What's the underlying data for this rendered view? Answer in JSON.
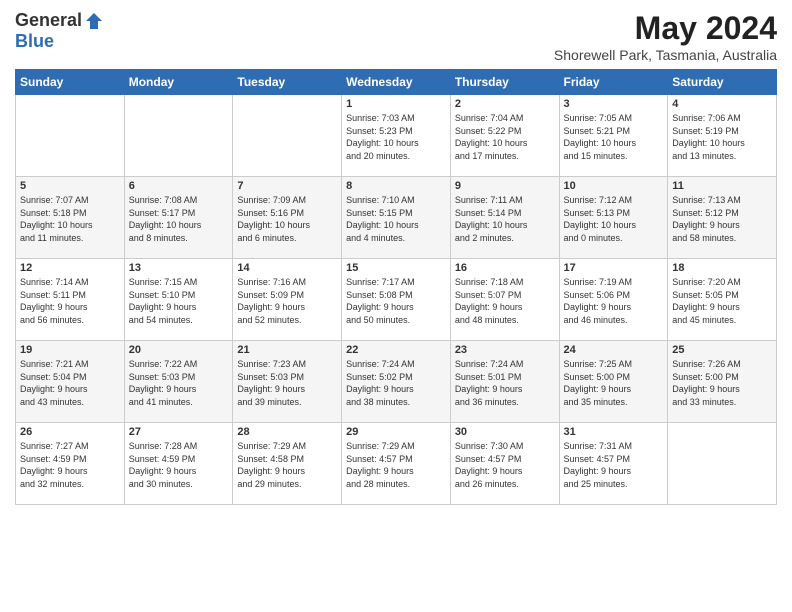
{
  "logo": {
    "general": "General",
    "blue": "Blue"
  },
  "title": "May 2024",
  "subtitle": "Shorewell Park, Tasmania, Australia",
  "days_of_week": [
    "Sunday",
    "Monday",
    "Tuesday",
    "Wednesday",
    "Thursday",
    "Friday",
    "Saturday"
  ],
  "weeks": [
    [
      {
        "num": "",
        "info": ""
      },
      {
        "num": "",
        "info": ""
      },
      {
        "num": "",
        "info": ""
      },
      {
        "num": "1",
        "info": "Sunrise: 7:03 AM\nSunset: 5:23 PM\nDaylight: 10 hours\nand 20 minutes."
      },
      {
        "num": "2",
        "info": "Sunrise: 7:04 AM\nSunset: 5:22 PM\nDaylight: 10 hours\nand 17 minutes."
      },
      {
        "num": "3",
        "info": "Sunrise: 7:05 AM\nSunset: 5:21 PM\nDaylight: 10 hours\nand 15 minutes."
      },
      {
        "num": "4",
        "info": "Sunrise: 7:06 AM\nSunset: 5:19 PM\nDaylight: 10 hours\nand 13 minutes."
      }
    ],
    [
      {
        "num": "5",
        "info": "Sunrise: 7:07 AM\nSunset: 5:18 PM\nDaylight: 10 hours\nand 11 minutes."
      },
      {
        "num": "6",
        "info": "Sunrise: 7:08 AM\nSunset: 5:17 PM\nDaylight: 10 hours\nand 8 minutes."
      },
      {
        "num": "7",
        "info": "Sunrise: 7:09 AM\nSunset: 5:16 PM\nDaylight: 10 hours\nand 6 minutes."
      },
      {
        "num": "8",
        "info": "Sunrise: 7:10 AM\nSunset: 5:15 PM\nDaylight: 10 hours\nand 4 minutes."
      },
      {
        "num": "9",
        "info": "Sunrise: 7:11 AM\nSunset: 5:14 PM\nDaylight: 10 hours\nand 2 minutes."
      },
      {
        "num": "10",
        "info": "Sunrise: 7:12 AM\nSunset: 5:13 PM\nDaylight: 10 hours\nand 0 minutes."
      },
      {
        "num": "11",
        "info": "Sunrise: 7:13 AM\nSunset: 5:12 PM\nDaylight: 9 hours\nand 58 minutes."
      }
    ],
    [
      {
        "num": "12",
        "info": "Sunrise: 7:14 AM\nSunset: 5:11 PM\nDaylight: 9 hours\nand 56 minutes."
      },
      {
        "num": "13",
        "info": "Sunrise: 7:15 AM\nSunset: 5:10 PM\nDaylight: 9 hours\nand 54 minutes."
      },
      {
        "num": "14",
        "info": "Sunrise: 7:16 AM\nSunset: 5:09 PM\nDaylight: 9 hours\nand 52 minutes."
      },
      {
        "num": "15",
        "info": "Sunrise: 7:17 AM\nSunset: 5:08 PM\nDaylight: 9 hours\nand 50 minutes."
      },
      {
        "num": "16",
        "info": "Sunrise: 7:18 AM\nSunset: 5:07 PM\nDaylight: 9 hours\nand 48 minutes."
      },
      {
        "num": "17",
        "info": "Sunrise: 7:19 AM\nSunset: 5:06 PM\nDaylight: 9 hours\nand 46 minutes."
      },
      {
        "num": "18",
        "info": "Sunrise: 7:20 AM\nSunset: 5:05 PM\nDaylight: 9 hours\nand 45 minutes."
      }
    ],
    [
      {
        "num": "19",
        "info": "Sunrise: 7:21 AM\nSunset: 5:04 PM\nDaylight: 9 hours\nand 43 minutes."
      },
      {
        "num": "20",
        "info": "Sunrise: 7:22 AM\nSunset: 5:03 PM\nDaylight: 9 hours\nand 41 minutes."
      },
      {
        "num": "21",
        "info": "Sunrise: 7:23 AM\nSunset: 5:03 PM\nDaylight: 9 hours\nand 39 minutes."
      },
      {
        "num": "22",
        "info": "Sunrise: 7:24 AM\nSunset: 5:02 PM\nDaylight: 9 hours\nand 38 minutes."
      },
      {
        "num": "23",
        "info": "Sunrise: 7:24 AM\nSunset: 5:01 PM\nDaylight: 9 hours\nand 36 minutes."
      },
      {
        "num": "24",
        "info": "Sunrise: 7:25 AM\nSunset: 5:00 PM\nDaylight: 9 hours\nand 35 minutes."
      },
      {
        "num": "25",
        "info": "Sunrise: 7:26 AM\nSunset: 5:00 PM\nDaylight: 9 hours\nand 33 minutes."
      }
    ],
    [
      {
        "num": "26",
        "info": "Sunrise: 7:27 AM\nSunset: 4:59 PM\nDaylight: 9 hours\nand 32 minutes."
      },
      {
        "num": "27",
        "info": "Sunrise: 7:28 AM\nSunset: 4:59 PM\nDaylight: 9 hours\nand 30 minutes."
      },
      {
        "num": "28",
        "info": "Sunrise: 7:29 AM\nSunset: 4:58 PM\nDaylight: 9 hours\nand 29 minutes."
      },
      {
        "num": "29",
        "info": "Sunrise: 7:29 AM\nSunset: 4:57 PM\nDaylight: 9 hours\nand 28 minutes."
      },
      {
        "num": "30",
        "info": "Sunrise: 7:30 AM\nSunset: 4:57 PM\nDaylight: 9 hours\nand 26 minutes."
      },
      {
        "num": "31",
        "info": "Sunrise: 7:31 AM\nSunset: 4:57 PM\nDaylight: 9 hours\nand 25 minutes."
      },
      {
        "num": "",
        "info": ""
      }
    ]
  ]
}
